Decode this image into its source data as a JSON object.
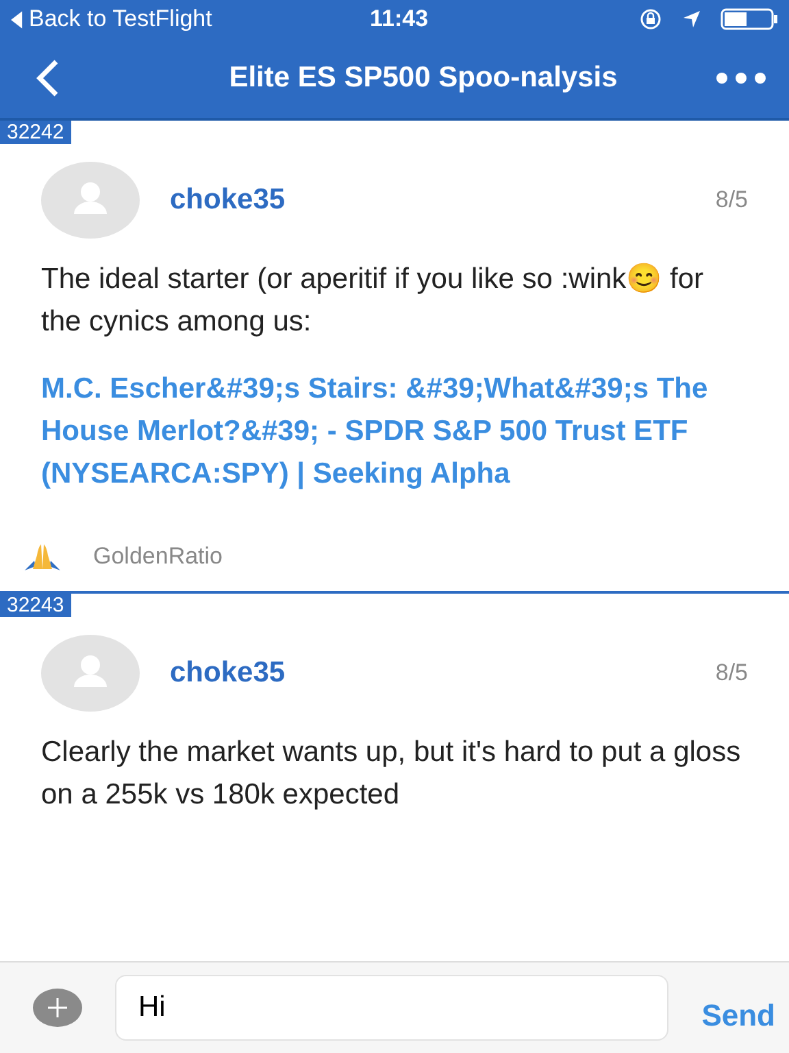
{
  "status_bar": {
    "back_label": "Back to TestFlight",
    "time": "11:43"
  },
  "nav": {
    "title": "Elite ES SP500 Spoo-nalysis"
  },
  "posts": [
    {
      "number": "32242",
      "author": "choke35",
      "date": "8/5",
      "body": "The ideal starter (or aperitif if you like so :wink😊 for the cynics among us:",
      "link": "M.C. Escher&#39;s Stairs: &#39;What&#39;s The House Merlot?&#39; - SPDR S&P 500 Trust ETF (NYSEARCA:SPY) | Seeking Alpha",
      "reactions": [
        {
          "user": "GoldenRatio"
        }
      ]
    },
    {
      "number": "32243",
      "author": "choke35",
      "date": "8/5",
      "body": "Clearly the market wants up, but it's hard to put a gloss on a 255k vs 180k expected"
    }
  ],
  "composer": {
    "value": "Hi",
    "send_label": "Send"
  }
}
